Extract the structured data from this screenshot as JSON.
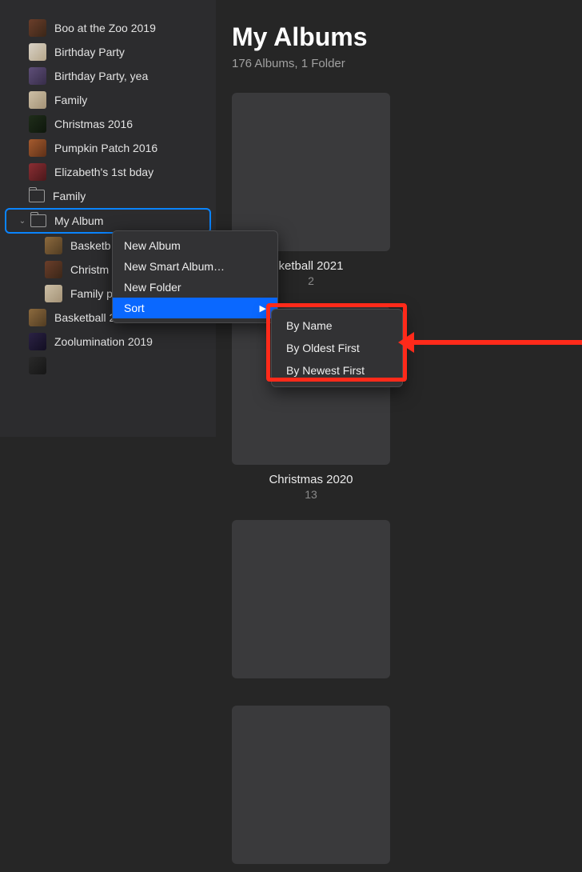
{
  "sidebar": {
    "items": [
      {
        "label": "Boo at the Zoo 2019",
        "thumb": "p-warm"
      },
      {
        "label": "Birthday Party",
        "thumb": "p-cake"
      },
      {
        "label": "Birthday Party, yea",
        "thumb": "p-purple"
      },
      {
        "label": "Family",
        "thumb": "p-beige"
      },
      {
        "label": "Christmas 2016",
        "thumb": "p-tree"
      },
      {
        "label": "Pumpkin Patch 2016",
        "thumb": "p-orange"
      },
      {
        "label": "Elizabeth's 1st bday",
        "thumb": "p-red"
      },
      {
        "label": "Family",
        "thumb": "folder"
      },
      {
        "label": "My Album",
        "thumb": "folder",
        "selected": true,
        "expanded": true
      },
      {
        "label": "Basketb",
        "thumb": "p-court",
        "child": true
      },
      {
        "label": "Christm",
        "thumb": "p-warm",
        "child": true
      },
      {
        "label": "Family p",
        "thumb": "p-beige",
        "child": true
      },
      {
        "label": "Basketball 2020",
        "thumb": "p-court"
      },
      {
        "label": "Zoolumination 2019",
        "thumb": "p-lights"
      },
      {
        "label": "",
        "thumb": "p-dark"
      }
    ]
  },
  "main": {
    "title": "My Albums",
    "subtitle": "176 Albums, 1 Folder",
    "albums": [
      {
        "title": "ketball 2021",
        "count": "2",
        "cover": "cov-family"
      },
      {
        "title": "Christmas 2020",
        "count": "13",
        "cover": "cov-xmas"
      },
      {
        "title": "",
        "count": "",
        "cover": "cov-indoor"
      },
      {
        "title": "",
        "count": "",
        "cover": "cov-raft"
      }
    ]
  },
  "menu": {
    "items": {
      "new_album": "New Album",
      "new_smart": "New Smart Album…",
      "new_folder": "New Folder",
      "sort": "Sort"
    },
    "sort_sub": {
      "by_name": "By Name",
      "by_oldest": "By Oldest First",
      "by_newest": "By Newest First"
    }
  }
}
